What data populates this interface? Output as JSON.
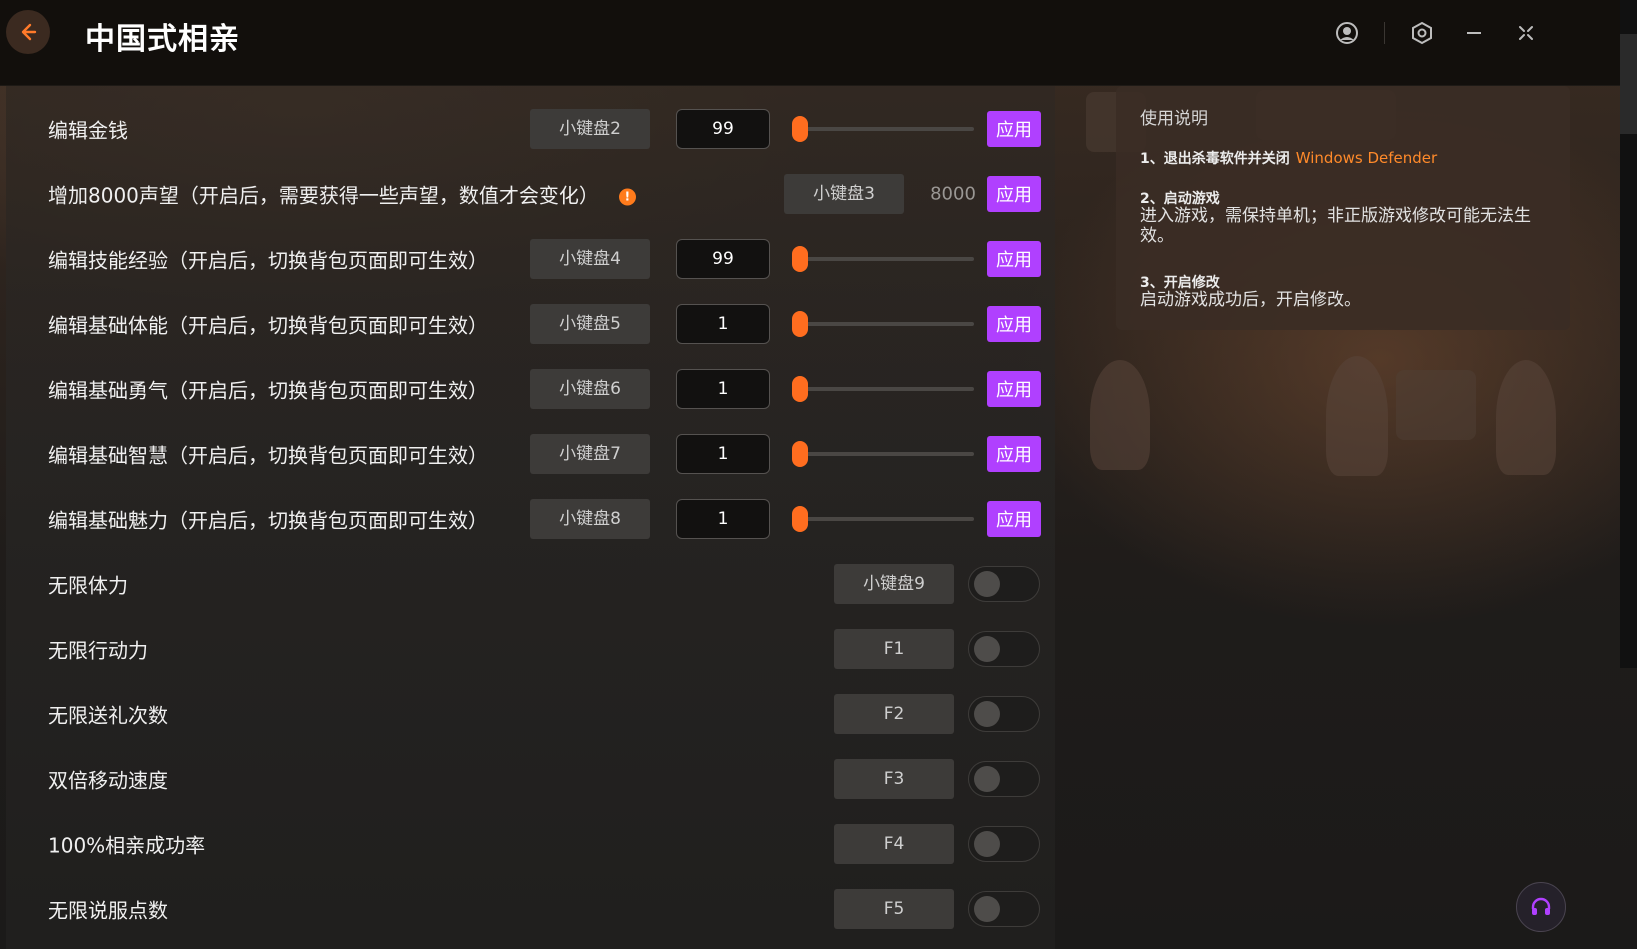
{
  "app": {
    "title": "中国式相亲",
    "accent_color": "#ff6d1f",
    "apply_color": "#b040ff"
  },
  "slider_rows": [
    {
      "label": "编辑金钱",
      "hotkey": "小键盘2",
      "value": "99",
      "apply": "应用"
    },
    {
      "label": "增加8000声望（开启后，需要获得一些声望，数值才会变化）",
      "hotkey": "小键盘3",
      "value": "8000",
      "apply": "应用"
    },
    {
      "label": "编辑技能经验（开启后，切换背包页面即可生效）",
      "hotkey": "小键盘4",
      "value": "99",
      "apply": "应用"
    },
    {
      "label": "编辑基础体能（开启后，切换背包页面即可生效）",
      "hotkey": "小键盘5",
      "value": "1",
      "apply": "应用"
    },
    {
      "label": "编辑基础勇气（开启后，切换背包页面即可生效）",
      "hotkey": "小键盘6",
      "value": "1",
      "apply": "应用"
    },
    {
      "label": "编辑基础智慧（开启后，切换背包页面即可生效）",
      "hotkey": "小键盘7",
      "value": "1",
      "apply": "应用"
    },
    {
      "label": "编辑基础魅力（开启后，切换背包页面即可生效）",
      "hotkey": "小键盘8",
      "value": "1",
      "apply": "应用"
    }
  ],
  "toggle_rows": [
    {
      "label": "无限体力",
      "hotkey": "小键盘9",
      "enabled": false
    },
    {
      "label": "无限行动力",
      "hotkey": "F1",
      "enabled": false
    },
    {
      "label": "无限送礼次数",
      "hotkey": "F2",
      "enabled": false
    },
    {
      "label": "双倍移动速度",
      "hotkey": "F3",
      "enabled": false
    },
    {
      "label": "100%相亲成功率",
      "hotkey": "F4",
      "enabled": false
    },
    {
      "label": "无限说服点数",
      "hotkey": "F5",
      "enabled": false
    }
  ],
  "instructions": {
    "title": "使用说明",
    "step1_head": "1、退出杀毒软件并关闭",
    "step1_accent": "Windows Defender",
    "step2_head": "2、启动游戏",
    "step2_body": "进入游戏，需保持单机；非正版游戏修改可能无法生效。",
    "step3_head": "3、开启修改",
    "step3_body": "启动游戏成功后，开启修改。"
  },
  "icons": {
    "back": "arrow-left-icon",
    "account": "user-icon",
    "settings": "settings-hex-icon",
    "minimize": "minimize-icon",
    "close": "close-icon",
    "help": "headset-icon",
    "info": "info-icon"
  }
}
